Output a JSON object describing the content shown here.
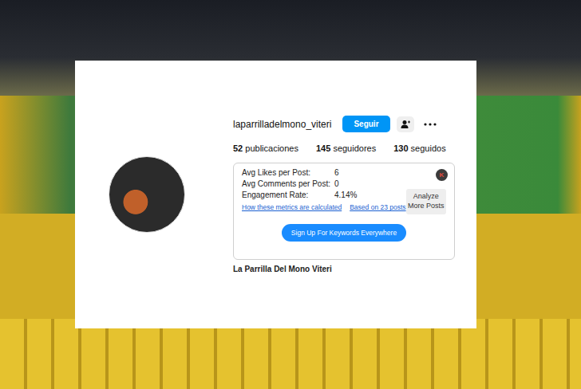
{
  "profile": {
    "username": "laparrilladelmono_viteri",
    "follow_button": "Seguir",
    "name": "La Parrilla Del Mono Viteri"
  },
  "stats": [
    {
      "count": "52",
      "label": "publicaciones"
    },
    {
      "count": "145",
      "label": "seguidores"
    },
    {
      "count": "130",
      "label": "seguidos"
    }
  ],
  "metrics": {
    "badge": "K",
    "rows": [
      {
        "label": "Avg Likes per Post:",
        "value": "6"
      },
      {
        "label": "Avg Comments per Post:",
        "value": "0"
      },
      {
        "label": "Engagement Rate:",
        "value": "4.14%"
      }
    ],
    "links": [
      "How these metrics are calculated",
      "Based on 23 posts"
    ],
    "analyze_button": "Analyze More Posts",
    "signup_button": "Sign Up For Keywords Everywhere"
  }
}
